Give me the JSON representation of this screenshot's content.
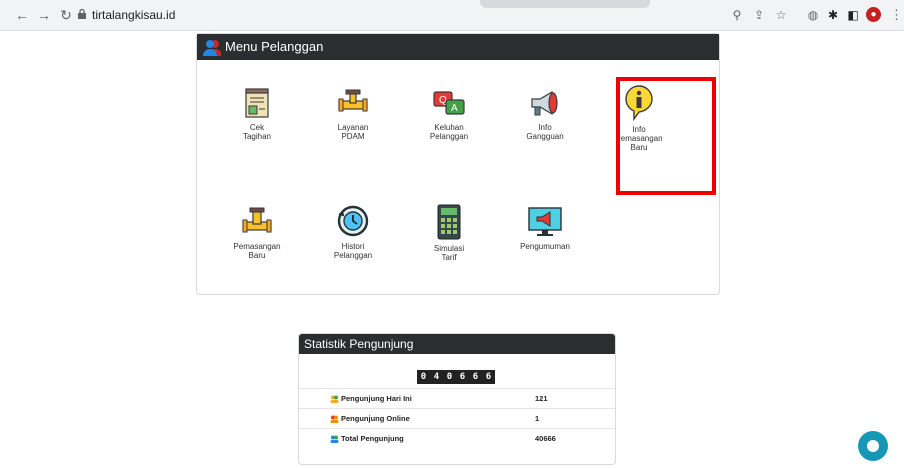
{
  "browser": {
    "url": "tirtalangkisau.id"
  },
  "menu": {
    "title": "Menu Pelanggan",
    "items": [
      {
        "label_line1": "Cek",
        "label_line2": "Tagihan"
      },
      {
        "label_line1": "Layanan",
        "label_line2": "PDAM"
      },
      {
        "label_line1": "Keluhan",
        "label_line2": "Pelanggan"
      },
      {
        "label_line1": "Info",
        "label_line2": "Gangguan"
      },
      {
        "label_line1": "Info",
        "label_line2": "Pemasangan",
        "label_line3": "Baru"
      },
      {
        "label_line1": "Pemasangan",
        "label_line2": "Baru"
      },
      {
        "label_line1": "Histori",
        "label_line2": "Pelanggan"
      },
      {
        "label_line1": "Simulasi",
        "label_line2": "Tarif"
      },
      {
        "label_line1": "Pengumuman"
      }
    ]
  },
  "stats": {
    "title": "Statistik Pengunjung",
    "counter_digits": [
      "0",
      "4",
      "0",
      "6",
      "6",
      "6"
    ],
    "rows": [
      {
        "label": "Pengunjung Hari Ini",
        "value": "121"
      },
      {
        "label": "Pengunjung Online",
        "value": "1"
      },
      {
        "label": "Total Pengunjung",
        "value": "40666"
      }
    ]
  },
  "colors": {
    "header_bg": "#2b2d30",
    "highlight": "#ee0000",
    "chat": "#1597b5"
  }
}
